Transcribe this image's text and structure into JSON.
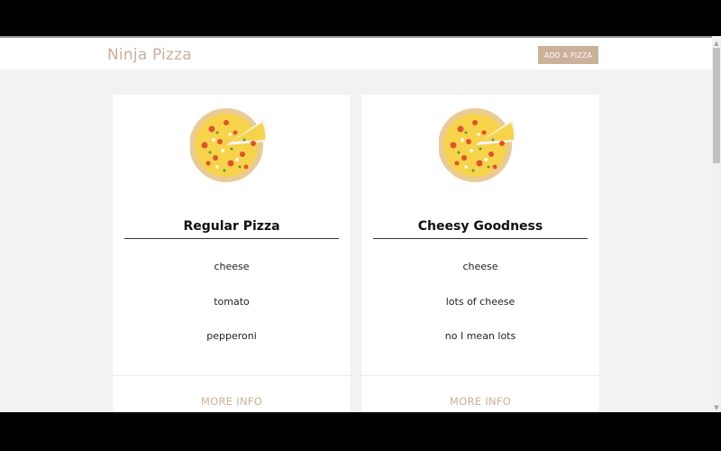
{
  "header": {
    "brand": "Ninja Pizza",
    "add_button_label": "ADD A PIZZA"
  },
  "pizzas": [
    {
      "title": "Regular Pizza",
      "ingredients": [
        "cheese",
        "tomato",
        "pepperoni"
      ],
      "more_info_label": "MORE INFO"
    },
    {
      "title": "Cheesy Goodness",
      "ingredients": [
        "cheese",
        "lots of cheese",
        "no I mean lots"
      ],
      "more_info_label": "MORE INFO"
    }
  ],
  "colors": {
    "accent": "#cbb09a",
    "page_bg": "#f2f2f2",
    "card_bg": "#ffffff"
  },
  "icons": {
    "pizza": "pizza-icon",
    "scroll_up": "scroll-up-arrow-icon",
    "scroll_down": "scroll-down-arrow-icon"
  }
}
